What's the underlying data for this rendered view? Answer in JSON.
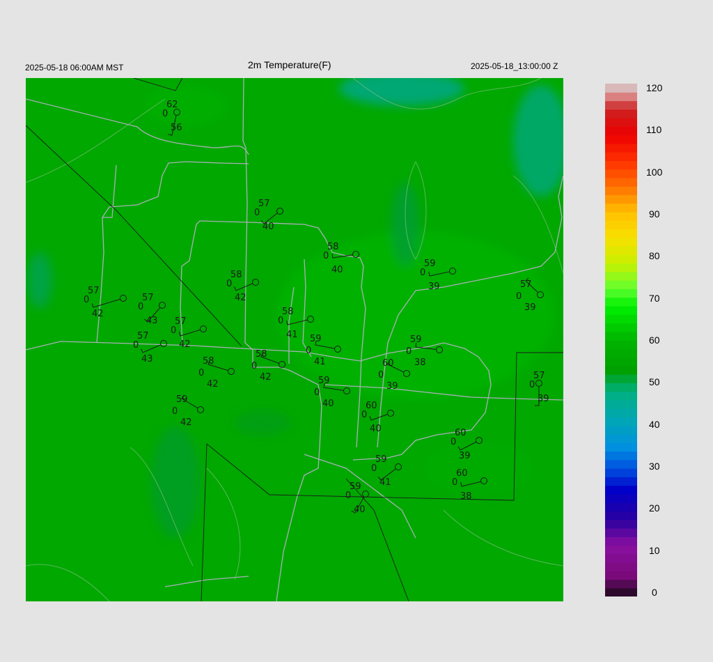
{
  "header": {
    "local_time": "2025-05-18 06:00AM MST",
    "title": "2m Temperature(F)",
    "utc_time": "2025-05-18_13:00:00 Z"
  },
  "colorbar": {
    "labels": [
      "120",
      "110",
      "100",
      "90",
      "80",
      "70",
      "60",
      "50",
      "40",
      "30",
      "20",
      "10",
      "0"
    ],
    "min": 0,
    "max": 120,
    "stops": [
      {
        "v": 0,
        "c": "#1a0a1a"
      },
      {
        "v": 5,
        "c": "#7a0a7a"
      },
      {
        "v": 12,
        "c": "#8a10a0"
      },
      {
        "v": 18,
        "c": "#2a00a0"
      },
      {
        "v": 25,
        "c": "#0000c8"
      },
      {
        "v": 30,
        "c": "#0050e0"
      },
      {
        "v": 35,
        "c": "#0090e0"
      },
      {
        "v": 42,
        "c": "#00a8b0"
      },
      {
        "v": 48,
        "c": "#00b080"
      },
      {
        "v": 53,
        "c": "#00a000"
      },
      {
        "v": 60,
        "c": "#00b400"
      },
      {
        "v": 68,
        "c": "#00f000"
      },
      {
        "v": 72,
        "c": "#60ff30"
      },
      {
        "v": 78,
        "c": "#c8f000"
      },
      {
        "v": 84,
        "c": "#f8e000"
      },
      {
        "v": 90,
        "c": "#ffc000"
      },
      {
        "v": 96,
        "c": "#ff7000"
      },
      {
        "v": 102,
        "c": "#ff3000"
      },
      {
        "v": 108,
        "c": "#ee0000"
      },
      {
        "v": 114,
        "c": "#cc2020"
      },
      {
        "v": 118,
        "c": "#e0a0a0"
      },
      {
        "v": 120,
        "c": "#d0d0d0"
      }
    ]
  },
  "stations": [
    {
      "t": "62",
      "w": "0",
      "td": "56"
    },
    {
      "t": "57",
      "w": "0",
      "td": "40"
    },
    {
      "t": "58",
      "w": "0",
      "td": "40"
    },
    {
      "t": "59",
      "w": "0",
      "td": "39"
    },
    {
      "t": "57",
      "w": "0",
      "td": "39"
    },
    {
      "t": "57",
      "w": "0",
      "td": "42"
    },
    {
      "t": "57",
      "w": "0",
      "td": "43"
    },
    {
      "t": "58",
      "w": "0",
      "td": "42"
    },
    {
      "t": "58",
      "w": "0",
      "td": "41"
    },
    {
      "t": "57",
      "w": "0",
      "td": "42"
    },
    {
      "t": "57",
      "w": "0",
      "td": "43"
    },
    {
      "t": "59",
      "w": "0",
      "td": "41"
    },
    {
      "t": "59",
      "w": "0",
      "td": "38"
    },
    {
      "t": "58",
      "w": "0",
      "td": "42"
    },
    {
      "t": "58",
      "w": "0",
      "td": "42"
    },
    {
      "t": "60",
      "w": "0",
      "td": "39"
    },
    {
      "t": "57",
      "w": "0",
      "td": "39"
    },
    {
      "t": "59",
      "w": "0",
      "td": "40"
    },
    {
      "t": "59",
      "w": "0",
      "td": "42"
    },
    {
      "t": "60",
      "w": "0",
      "td": "40"
    },
    {
      "t": "60",
      "w": "0",
      "td": "39"
    },
    {
      "t": "59",
      "w": "0",
      "td": "41"
    },
    {
      "t": "60",
      "w": "0",
      "td": "38"
    },
    {
      "t": "59",
      "w": "0",
      "td": "40"
    }
  ]
}
